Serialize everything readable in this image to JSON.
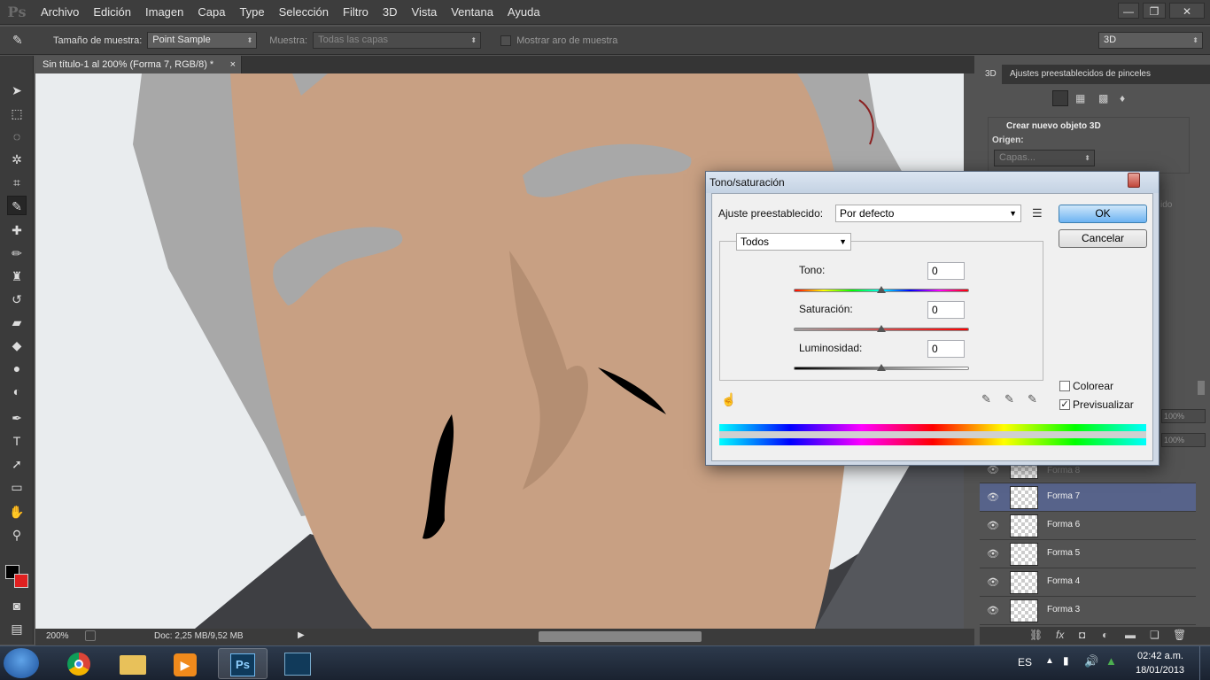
{
  "app": {
    "logo": "Ps",
    "menu": [
      "Archivo",
      "Edición",
      "Imagen",
      "Capa",
      "Type",
      "Selección",
      "Filtro",
      "3D",
      "Vista",
      "Ventana",
      "Ayuda"
    ],
    "window_controls": [
      "—",
      "❐",
      "✕"
    ]
  },
  "options_bar": {
    "sample_size_label": "Tamaño de muestra:",
    "sample_size_value": "Point Sample",
    "sample_label": "Muestra:",
    "sample_value": "Todas las capas",
    "show_ring_label": "Mostrar aro de muestra",
    "workspace_value": "3D"
  },
  "document": {
    "tab_title": "Sin título-1 al 200% (Forma 7, RGB/8) *",
    "zoom": "200%",
    "doc_info": "Doc: 2,25 MB/9,52 MB"
  },
  "right_panel": {
    "tabs": [
      "3D",
      "Ajustes preestablecidos de pinceles"
    ],
    "create_3d_title": "Crear nuevo objeto 3D",
    "origin_label": "Origen:",
    "origin_value": "Capas...",
    "faded_text": "ido",
    "opacity_value": "100%",
    "fill_value": "100%",
    "layers": [
      {
        "name": "Forma 8",
        "selected": false
      },
      {
        "name": "Forma 7",
        "selected": true
      },
      {
        "name": "Forma 6",
        "selected": false
      },
      {
        "name": "Forma 5",
        "selected": false
      },
      {
        "name": "Forma 4",
        "selected": false
      },
      {
        "name": "Forma 3",
        "selected": false
      }
    ]
  },
  "dialog": {
    "title": "Tono/saturación",
    "preset_label": "Ajuste preestablecido:",
    "preset_value": "Por defecto",
    "ok_label": "OK",
    "cancel_label": "Cancelar",
    "channel_value": "Todos",
    "hue_label": "Tono:",
    "hue_value": "0",
    "saturation_label": "Saturación:",
    "saturation_value": "0",
    "lightness_label": "Luminosidad:",
    "lightness_value": "0",
    "colorize_label": "Colorear",
    "preview_label": "Previsualizar",
    "preview_checked": true,
    "colorize_checked": false
  },
  "taskbar": {
    "language": "ES",
    "time": "02:42 a.m.",
    "date": "18/01/2013"
  },
  "colors": {
    "foreground": "#000000",
    "background": "#e02020",
    "skin": "#c8a083",
    "hair": "#a9a9a9",
    "selected_layer": "#57638a"
  }
}
